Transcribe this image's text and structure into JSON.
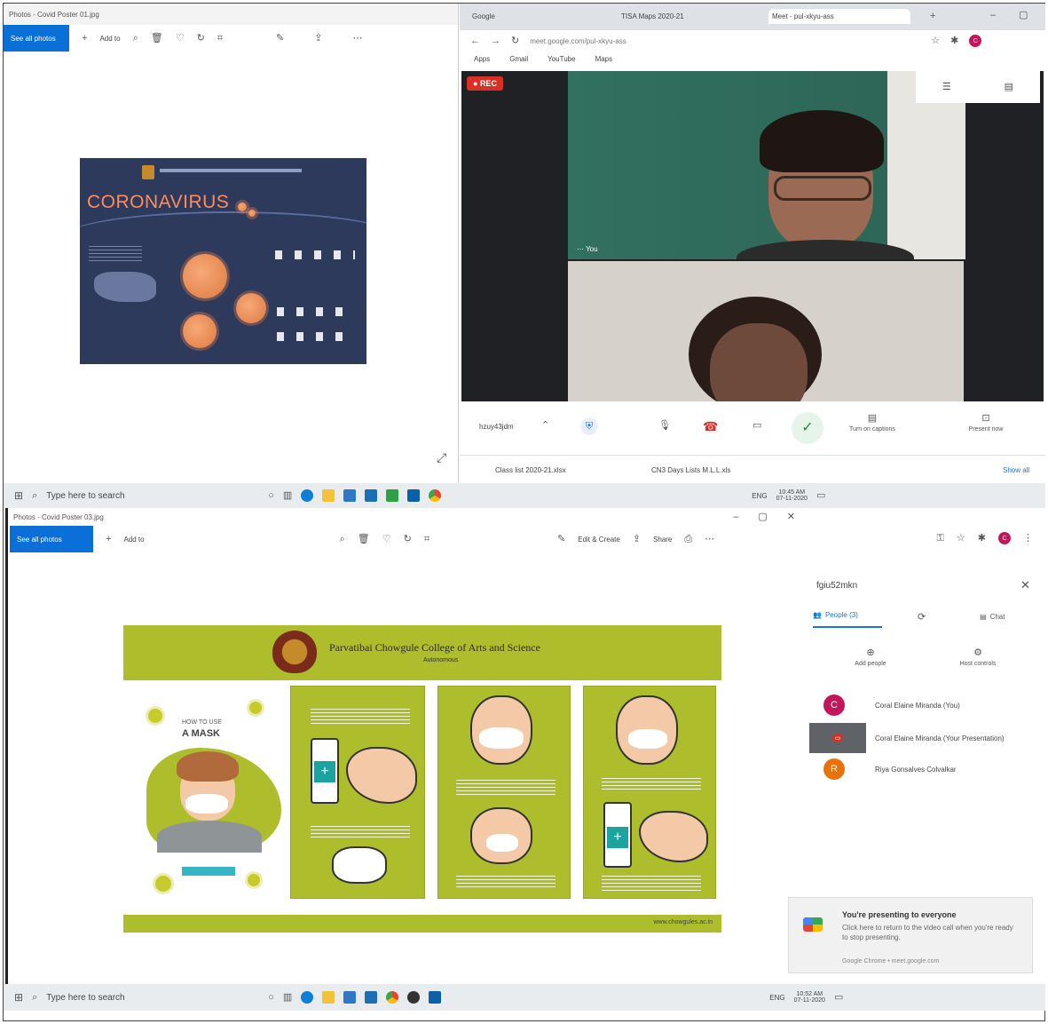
{
  "top_left": {
    "window_title": "Photos - Covid Poster 01.jpg",
    "see_all": "See all photos",
    "add_to": "Add to",
    "poster_title": "CORONAVIRUS"
  },
  "top_right": {
    "tabs": [
      {
        "label": "Google"
      },
      {
        "label": "TISA Maps 2020-21"
      },
      {
        "label": "Meet - pul-xkyu-ass"
      }
    ],
    "url": "meet.google.com/pul-xkyu-ass",
    "bookmarks": [
      "Apps",
      "Gmail",
      "YouTube",
      "Maps"
    ],
    "rec_label": "REC",
    "you_label": "You",
    "meeting_code": "hzuy43jdm",
    "turn_on_captions": "Turn on captions",
    "present_now": "Present now",
    "downloads": [
      "Class list 2020-21.xlsx",
      "CN3 Days Lists M.L.L.xls"
    ],
    "show_all": "Show all"
  },
  "taskbar_top": {
    "search_placeholder": "Type here to search",
    "time": "10:45 AM",
    "date": "07-11-2020",
    "lang": "ENG"
  },
  "photos_main": {
    "window_title": "Photos - Covid Poster 03.jpg",
    "see_all": "See all photos",
    "add_to": "Add to",
    "edit_create": "Edit & Create",
    "share": "Share"
  },
  "poster": {
    "college": "Parvatibai Chowgule College of Arts and Science",
    "subtitle": "Autonomous",
    "how_to_use": "HOW TO USE",
    "a_mask": "A MASK",
    "footer_url": "www.chowgules.ac.in"
  },
  "meet_panel": {
    "code": "fgiu52mkn",
    "people_tab": "People (3)",
    "chat_tab": "Chat",
    "add_people": "Add people",
    "host_controls": "Host controls",
    "participants": [
      {
        "initial": "C",
        "name": "Coral Elaine Miranda (You)",
        "color": "#c2185b"
      },
      {
        "initial": "",
        "name": "Coral Elaine Miranda (Your Presentation)",
        "color": "#5f6368"
      },
      {
        "initial": "R",
        "name": "Riya Gonsalves Colvalkar",
        "color": "#e8710a"
      }
    ]
  },
  "notification": {
    "title": "You're presenting to everyone",
    "body": "Click here to return to the video call when you're ready to stop presenting.",
    "source": "Google Chrome • meet.google.com"
  },
  "taskbar_bottom": {
    "search_placeholder": "Type here to search",
    "time": "10:52 AM",
    "date": "07-11-2020",
    "lang": "ENG"
  }
}
